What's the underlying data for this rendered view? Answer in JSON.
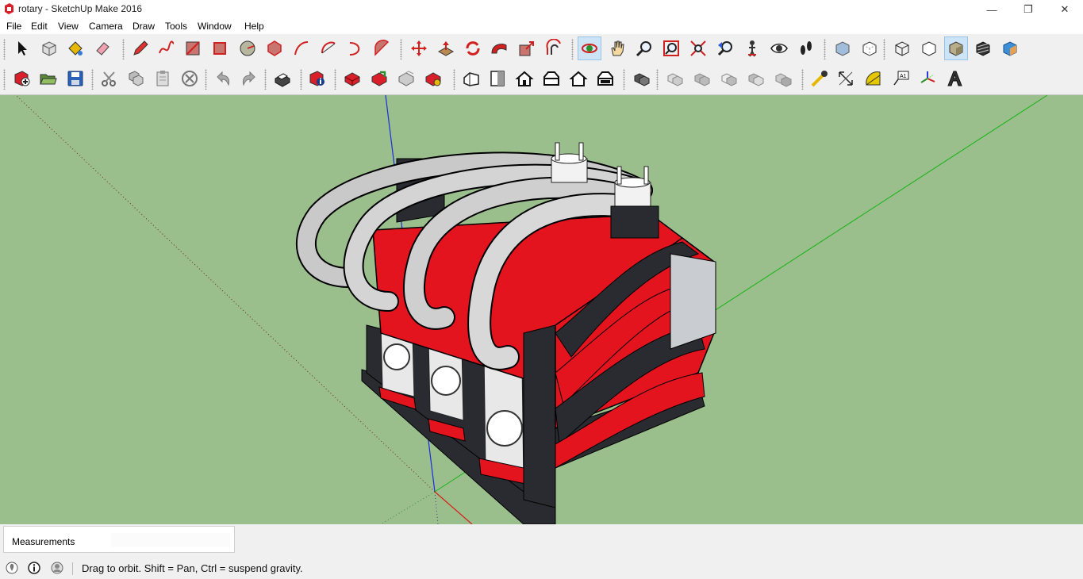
{
  "window": {
    "title": "rotary - SketchUp Make 2016",
    "controls": {
      "minimize": "—",
      "restore": "❐",
      "close": "✕"
    }
  },
  "menu": [
    "File",
    "Edit",
    "View",
    "Camera",
    "Draw",
    "Tools",
    "Window",
    "Help"
  ],
  "toolbar_top": [
    {
      "name": "select-tool",
      "icon": "arrow-cursor-icon"
    },
    {
      "name": "make-component-tool",
      "icon": "component-box-icon"
    },
    {
      "name": "paint-bucket-tool",
      "icon": "paint-bucket-icon"
    },
    {
      "name": "eraser-tool",
      "icon": "eraser-icon"
    },
    {
      "name": "line-tool",
      "icon": "pencil-icon"
    },
    {
      "name": "freehand-tool",
      "icon": "freehand-icon"
    },
    {
      "name": "rectangle-tool",
      "icon": "rectangle-icon"
    },
    {
      "name": "rotated-rectangle-tool",
      "icon": "rotated-rectangle-icon"
    },
    {
      "name": "circle-tool",
      "icon": "circle-icon"
    },
    {
      "name": "polygon-tool",
      "icon": "polygon-icon"
    },
    {
      "name": "arc-tool",
      "icon": "arc-icon"
    },
    {
      "name": "two-point-arc-tool",
      "icon": "two-point-arc-icon"
    },
    {
      "name": "three-point-arc-tool",
      "icon": "three-point-arc-icon"
    },
    {
      "name": "pie-tool",
      "icon": "pie-icon"
    },
    {
      "name": "move-tool",
      "icon": "move-arrows-icon"
    },
    {
      "name": "push-pull-tool",
      "icon": "push-pull-icon"
    },
    {
      "name": "rotate-tool",
      "icon": "rotate-icon"
    },
    {
      "name": "follow-me-tool",
      "icon": "follow-me-icon"
    },
    {
      "name": "scale-tool",
      "icon": "scale-icon"
    },
    {
      "name": "offset-tool",
      "icon": "offset-icon"
    },
    {
      "name": "orbit-tool",
      "icon": "orbit-icon",
      "active": true
    },
    {
      "name": "pan-tool",
      "icon": "hand-icon"
    },
    {
      "name": "zoom-tool",
      "icon": "magnifier-icon"
    },
    {
      "name": "zoom-window-tool",
      "icon": "zoom-window-icon"
    },
    {
      "name": "zoom-extents-tool",
      "icon": "zoom-extents-icon"
    },
    {
      "name": "previous-view-tool",
      "icon": "previous-view-icon"
    },
    {
      "name": "position-camera-tool",
      "icon": "position-camera-icon"
    },
    {
      "name": "look-around-tool",
      "icon": "eye-icon"
    },
    {
      "name": "walk-tool",
      "icon": "footprints-icon"
    },
    {
      "name": "xray-style",
      "icon": "xray-style-icon"
    },
    {
      "name": "back-edges-style",
      "icon": "back-edges-style-icon"
    },
    {
      "name": "wireframe-style",
      "icon": "wireframe-style-icon"
    },
    {
      "name": "hidden-line-style",
      "icon": "hidden-line-style-icon"
    },
    {
      "name": "shaded-style",
      "icon": "shaded-style-icon",
      "active": true
    },
    {
      "name": "shaded-textures-style",
      "icon": "shaded-textures-style-icon"
    },
    {
      "name": "monochrome-style",
      "icon": "monochrome-style-icon"
    }
  ],
  "toolbar_bottom": [
    {
      "name": "new-file",
      "icon": "new-file-icon"
    },
    {
      "name": "open-file",
      "icon": "open-folder-icon"
    },
    {
      "name": "save-file",
      "icon": "floppy-disk-icon"
    },
    {
      "name": "cut",
      "icon": "scissors-icon"
    },
    {
      "name": "copy",
      "icon": "copy-icon"
    },
    {
      "name": "paste",
      "icon": "paste-icon"
    },
    {
      "name": "erase",
      "icon": "delete-circle-icon"
    },
    {
      "name": "undo",
      "icon": "undo-icon"
    },
    {
      "name": "redo",
      "icon": "redo-icon"
    },
    {
      "name": "print",
      "icon": "printer-icon"
    },
    {
      "name": "model-info",
      "icon": "model-info-icon"
    },
    {
      "name": "3d-warehouse",
      "icon": "warehouse-icon"
    },
    {
      "name": "share-model",
      "icon": "share-model-icon"
    },
    {
      "name": "share-component",
      "icon": "share-component-icon"
    },
    {
      "name": "extension-warehouse",
      "icon": "extension-warehouse-icon"
    },
    {
      "name": "iso-view",
      "icon": "iso-house-icon"
    },
    {
      "name": "top-view",
      "icon": "top-view-icon"
    },
    {
      "name": "front-view",
      "icon": "front-house-icon"
    },
    {
      "name": "right-view",
      "icon": "right-house-icon"
    },
    {
      "name": "back-view",
      "icon": "back-house-icon"
    },
    {
      "name": "left-view",
      "icon": "left-house-icon"
    },
    {
      "name": "outer-shell",
      "icon": "outer-shell-icon"
    },
    {
      "name": "intersect",
      "icon": "intersect-icon"
    },
    {
      "name": "union",
      "icon": "union-icon"
    },
    {
      "name": "subtract",
      "icon": "subtract-icon"
    },
    {
      "name": "trim",
      "icon": "trim-icon"
    },
    {
      "name": "split",
      "icon": "split-icon"
    },
    {
      "name": "tape-measure-tool",
      "icon": "tape-measure-icon"
    },
    {
      "name": "dimension-tool",
      "icon": "dimension-icon"
    },
    {
      "name": "protractor-tool",
      "icon": "protractor-icon"
    },
    {
      "name": "text-tool",
      "icon": "text-label-icon"
    },
    {
      "name": "axes-tool",
      "icon": "axes-icon"
    },
    {
      "name": "3d-text-tool",
      "icon": "3d-text-icon"
    }
  ],
  "measurements": {
    "label": "Measurements",
    "value": ""
  },
  "status": {
    "icons": [
      "geo-location-icon",
      "info-icon",
      "user-icon"
    ],
    "text": "Drag to orbit. Shift = Pan, Ctrl = suspend gravity."
  },
  "colors": {
    "viewport_bg": "#9bbf8c",
    "model_red": "#e3141e",
    "model_dark": "#2a2b30",
    "model_silver": "#c9c9c9",
    "axis_blue": "#1b2ce0",
    "axis_green": "#17b317",
    "axis_red": "#d81b1b",
    "active_tool": "#cde4f7"
  }
}
